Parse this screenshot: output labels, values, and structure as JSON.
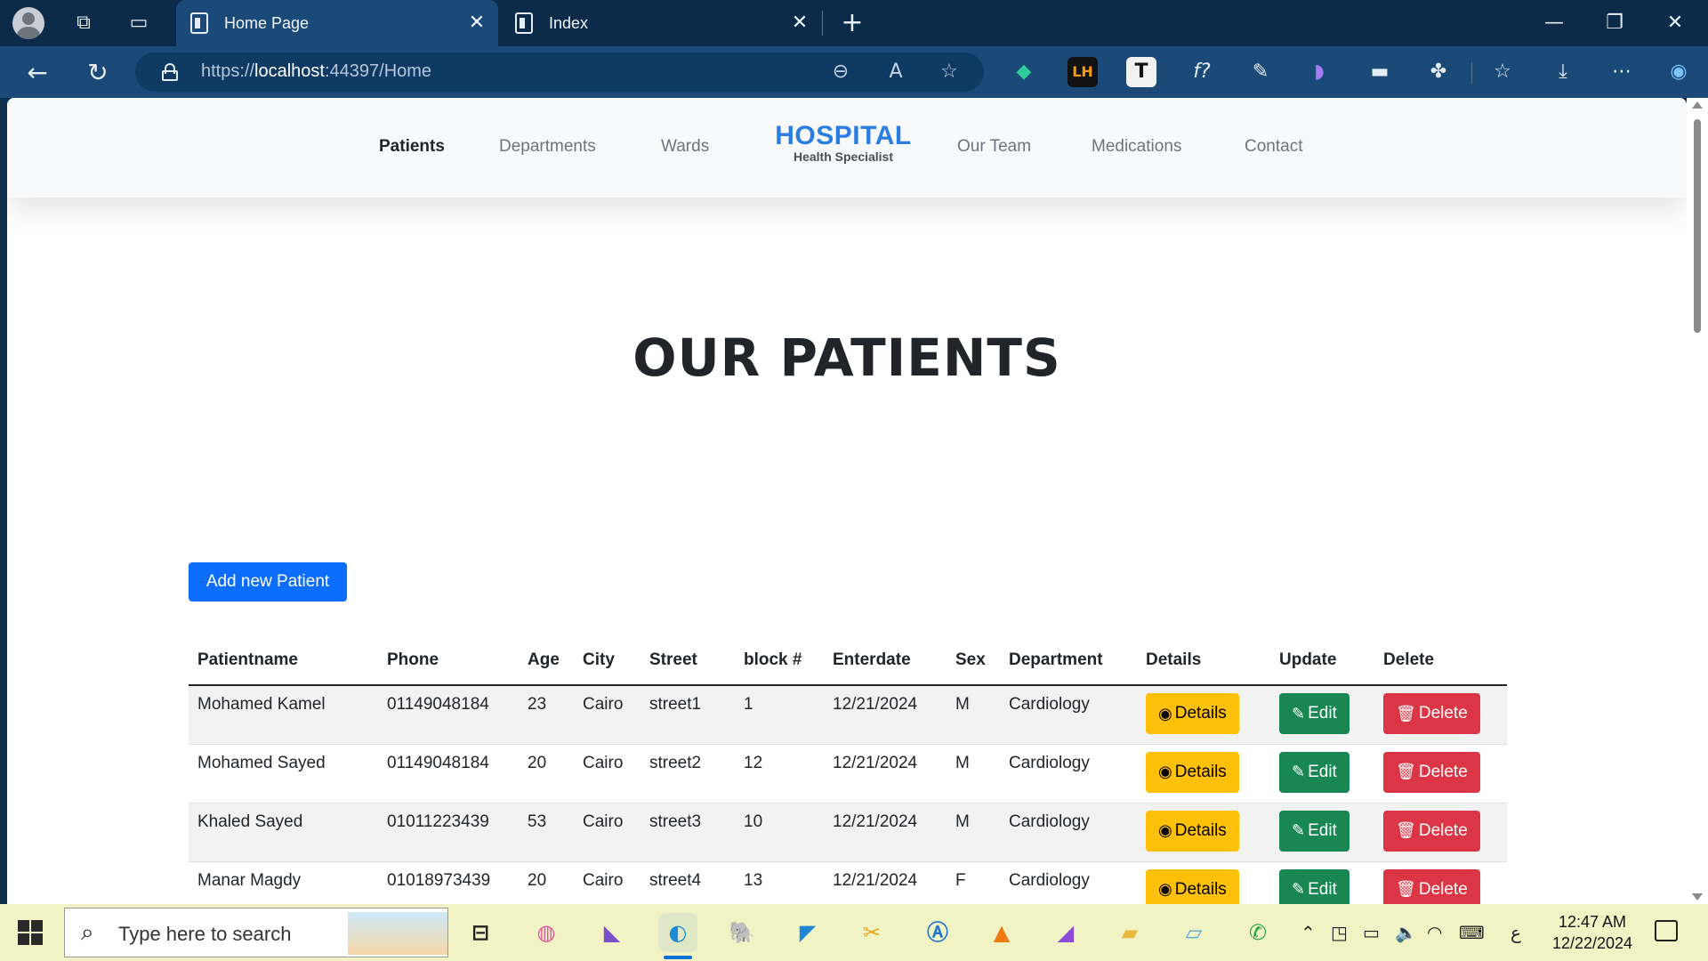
{
  "browser": {
    "tabs": [
      {
        "title": "Home Page",
        "active": true
      },
      {
        "title": "Index",
        "active": false
      }
    ],
    "url": {
      "scheme": "https://",
      "host": "localhost",
      "rest": ":44397/Home"
    }
  },
  "site": {
    "nav_left": [
      "Patients",
      "Departments",
      "Wards"
    ],
    "brand": {
      "name": "HOSPITAL",
      "tagline": "Health Specialist"
    },
    "nav_right": [
      "Our Team",
      "Medications",
      "Contact"
    ]
  },
  "page": {
    "title": "OUR PATIENTS",
    "add_button": "Add new Patient"
  },
  "table": {
    "headers": [
      "Patientname",
      "Phone",
      "Age",
      "City",
      "Street",
      "block #",
      "Enterdate",
      "Sex",
      "Department",
      "Details",
      "Update",
      "Delete"
    ],
    "rows": [
      {
        "name": "Mohamed Kamel",
        "phone": "01149048184",
        "age": "23",
        "city": "Cairo",
        "street": "street1",
        "block": "1",
        "date": "12/21/2024",
        "sex": "M",
        "dept": "Cardiology"
      },
      {
        "name": "Mohamed Sayed",
        "phone": "01149048184",
        "age": "20",
        "city": "Cairo",
        "street": "street2",
        "block": "12",
        "date": "12/21/2024",
        "sex": "M",
        "dept": "Cardiology"
      },
      {
        "name": "Khaled Sayed",
        "phone": "01011223439",
        "age": "53",
        "city": "Cairo",
        "street": "street3",
        "block": "10",
        "date": "12/21/2024",
        "sex": "M",
        "dept": "Cardiology"
      },
      {
        "name": "Manar Magdy",
        "phone": "01018973439",
        "age": "20",
        "city": "Cairo",
        "street": "street4",
        "block": "13",
        "date": "12/21/2024",
        "sex": "F",
        "dept": "Cardiology"
      }
    ],
    "actions": {
      "details": "Details",
      "edit": "Edit",
      "delete": "Delete"
    }
  },
  "taskbar": {
    "search_placeholder": "Type here to search",
    "time": "12:47 AM",
    "date": "12/22/2024",
    "lang": "ع"
  },
  "colors": {
    "primary": "#0d6efd",
    "warning": "#ffc107",
    "success": "#198754",
    "danger": "#dc3545",
    "brand": "#2a7de1"
  }
}
